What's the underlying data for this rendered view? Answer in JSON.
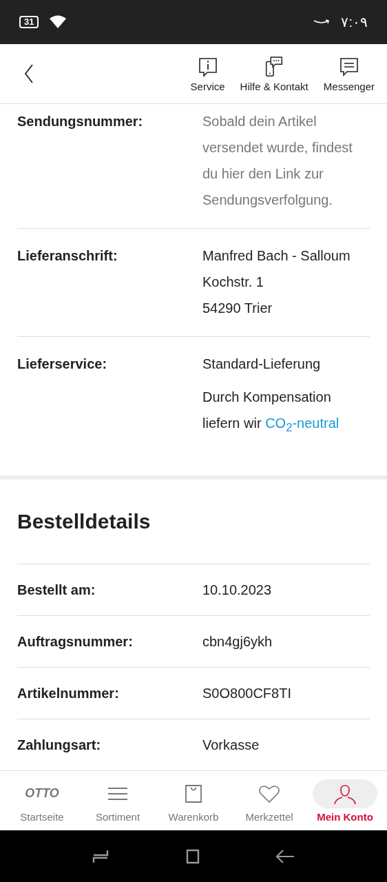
{
  "status_bar": {
    "battery": "31",
    "time": "٧:٠٩"
  },
  "header": {
    "actions": [
      {
        "label": "Service",
        "kind": "info"
      },
      {
        "label": "Hilfe & Kontakt",
        "kind": "phone"
      },
      {
        "label": "Messenger",
        "kind": "chat"
      }
    ]
  },
  "delivery_rows": [
    {
      "label": "Sendungsnummer:",
      "muted": true,
      "lines": [
        "Sobald dein Artikel versendet wurde, findest du hier den Link zur Sendungsverfolgung."
      ]
    },
    {
      "label": "Lieferanschrift:",
      "muted": false,
      "lines": [
        "Manfred Bach - Salloum",
        "Kochstr. 1",
        "54290 Trier"
      ]
    },
    {
      "label": "Lieferservice:",
      "muted": false,
      "lines": [
        "Standard-Lieferung"
      ],
      "note": {
        "text": "Durch Kompensation liefern wir",
        "link": "CO$_{2}$-neutral"
      }
    }
  ],
  "order_details": {
    "title": "Bestelldetails",
    "rows": [
      {
        "label": "Bestellt am:",
        "value": "10.10.2023"
      },
      {
        "label": "Auftragsnummer:",
        "value": "cbn4gj6ykh"
      },
      {
        "label": "Artikelnummer:",
        "value": "S0O800CF8TI"
      },
      {
        "label": "Zahlungsart:",
        "value": "Vorkasse"
      }
    ]
  },
  "bottom_nav": [
    {
      "label": "Startseite",
      "kind": "logo",
      "logo": "OTTO",
      "selected": false
    },
    {
      "label": "Sortiment",
      "kind": "menu",
      "selected": false
    },
    {
      "label": "Warenkorb",
      "kind": "bag",
      "selected": false
    },
    {
      "label": "Merkzettel",
      "kind": "heart",
      "selected": false
    },
    {
      "label": "Mein Konto",
      "kind": "person",
      "selected": true
    }
  ]
}
